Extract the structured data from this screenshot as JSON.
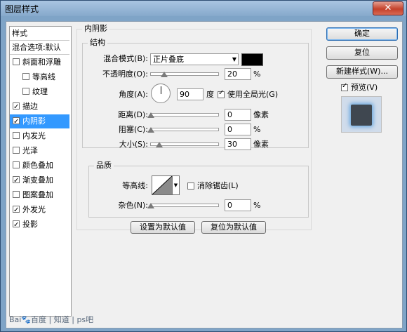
{
  "window": {
    "title": "图层样式",
    "close_glyph": "✕"
  },
  "sidebar": {
    "items": [
      {
        "label": "样式",
        "kind": "header"
      },
      {
        "label": "混合选项:默认",
        "kind": "header"
      },
      {
        "label": "斜面和浮雕",
        "checked": false
      },
      {
        "label": "等高线",
        "checked": false,
        "indent": true
      },
      {
        "label": "纹理",
        "checked": false,
        "indent": true
      },
      {
        "label": "描边",
        "checked": true
      },
      {
        "label": "内阴影",
        "checked": true,
        "selected": true
      },
      {
        "label": "内发光",
        "checked": false
      },
      {
        "label": "光泽",
        "checked": false
      },
      {
        "label": "颜色叠加",
        "checked": false
      },
      {
        "label": "渐变叠加",
        "checked": true
      },
      {
        "label": "图案叠加",
        "checked": false
      },
      {
        "label": "外发光",
        "checked": true
      },
      {
        "label": "投影",
        "checked": true
      }
    ]
  },
  "panel": {
    "title": "内阴影",
    "structure": {
      "title": "结构",
      "blend_mode": {
        "label": "混合模式(B):",
        "value": "正片叠底",
        "color": "#000000"
      },
      "opacity": {
        "label": "不透明度(O):",
        "value": "20",
        "unit": "%",
        "fraction": 0.2
      },
      "angle": {
        "label": "角度(A):",
        "value": "90",
        "unit": "度",
        "global_light_label": "使用全局光(G)",
        "global_light_checked": true
      },
      "distance": {
        "label": "距离(D):",
        "value": "0",
        "unit": "像素",
        "fraction": 0.0
      },
      "choke": {
        "label": "阻塞(C):",
        "value": "0",
        "unit": "%",
        "fraction": 0.0
      },
      "size": {
        "label": "大小(S):",
        "value": "30",
        "unit": "像素",
        "fraction": 0.12
      }
    },
    "quality": {
      "title": "品质",
      "contour": {
        "label": "等高线:",
        "antialias_label": "消除锯齿(L)",
        "antialias_checked": false
      },
      "noise": {
        "label": "杂色(N):",
        "value": "0",
        "unit": "%",
        "fraction": 0.0
      }
    },
    "set_default": "设置为默认值",
    "reset_default": "复位为默认值"
  },
  "actions": {
    "ok": "确定",
    "reset": "复位",
    "new_style": "新建样式(W)...",
    "preview_label": "预览(V)",
    "preview_checked": true
  },
  "watermark": "Bai🐾百度 | 知道 | ps吧"
}
